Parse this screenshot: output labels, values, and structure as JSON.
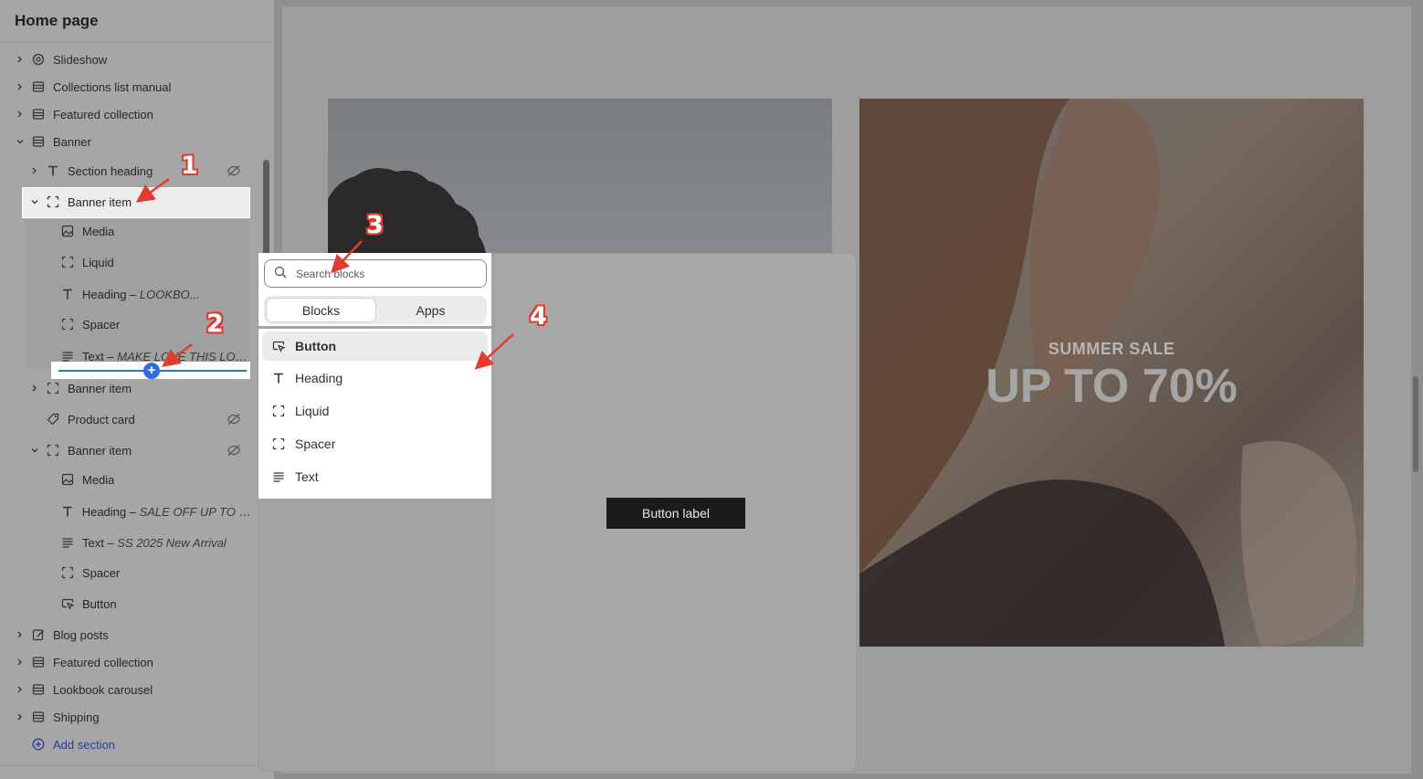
{
  "sidebar": {
    "title": "Home page",
    "sections": [
      {
        "label": "Slideshow",
        "icon": "slideshow-icon"
      },
      {
        "label": "Collections list manual",
        "icon": "section-icon"
      },
      {
        "label": "Featured collection",
        "icon": "section-icon"
      },
      {
        "label": "Banner",
        "icon": "section-icon"
      }
    ],
    "banner_children": {
      "section_heading": "Section heading",
      "banner_item_1": "Banner item",
      "media": "Media",
      "liquid": "Liquid",
      "heading_prefix": "Heading – ",
      "heading_value": "LOOKBO...",
      "spacer": "Spacer",
      "text_prefix": "Text – ",
      "text_value": "MAKE LOVE THIS LOOK",
      "banner_item_2": "Banner item",
      "product_card": "Product card",
      "banner_item_3": "Banner item",
      "media_2": "Media",
      "heading2_prefix": "Heading – ",
      "heading2_value": "SALE OFF UP TO 7...",
      "text2_prefix": "Text – ",
      "text2_value": "SS 2025 New Arrival",
      "spacer_2": "Spacer",
      "button": "Button"
    },
    "sections_after": [
      {
        "label": "Blog posts",
        "icon": "blog-icon"
      },
      {
        "label": "Featured collection",
        "icon": "section-icon"
      },
      {
        "label": "Lookbook carousel",
        "icon": "section-icon"
      },
      {
        "label": "Shipping",
        "icon": "section-icon"
      }
    ],
    "add_section": "Add section"
  },
  "picker": {
    "search_placeholder": "Search blocks",
    "tabs": [
      "Blocks",
      "Apps"
    ],
    "blocks": [
      "Button",
      "Heading",
      "Liquid",
      "Spacer",
      "Text"
    ]
  },
  "preview": {
    "button_label": "Button label",
    "summer_sale": "SUMMER SALE",
    "up_to": "UP TO 70%"
  },
  "annotations": [
    "1",
    "2",
    "3",
    "4"
  ],
  "colors": {
    "accent": "#2f6ee0",
    "annotation": "#e23c2f"
  }
}
